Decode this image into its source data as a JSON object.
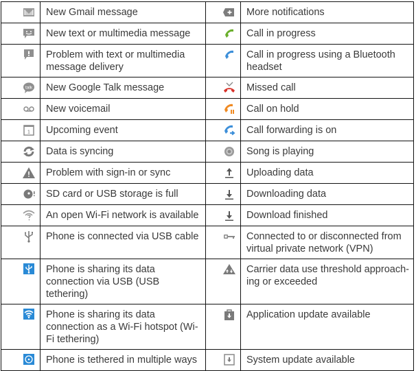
{
  "colors": {
    "gray_icon": "#8a8a8a",
    "call_green": "#6aaf2c",
    "call_blue": "#3d8fd9",
    "missed_red": "#d8332b",
    "hold_orange": "#f08a22",
    "tether_blue": "#2a8ad6"
  },
  "rows": [
    {
      "left": {
        "icon": "gmail-icon",
        "text": "New Gmail message"
      },
      "right": {
        "icon": "more-notifications-icon",
        "text": "More notifications"
      }
    },
    {
      "left": {
        "icon": "text-message-icon",
        "text": "New text or multimedia message"
      },
      "right": {
        "icon": "call-in-progress-icon",
        "text": "Call in progress"
      }
    },
    {
      "left": {
        "icon": "message-error-icon",
        "text": "Problem with text or multimedia message delivery"
      },
      "right": {
        "icon": "bluetooth-call-icon",
        "text": "Call in progress using a Bluetooth headset"
      }
    },
    {
      "left": {
        "icon": "google-talk-icon",
        "text": "New Google Talk message"
      },
      "right": {
        "icon": "missed-call-icon",
        "text": "Missed call"
      }
    },
    {
      "left": {
        "icon": "voicemail-icon",
        "text": "New voicemail"
      },
      "right": {
        "icon": "call-on-hold-icon",
        "text": "Call on hold"
      }
    },
    {
      "left": {
        "icon": "calendar-icon",
        "text": "Upcoming event"
      },
      "right": {
        "icon": "call-forwarding-icon",
        "text": "Call forwarding is on"
      }
    },
    {
      "left": {
        "icon": "sync-icon",
        "text": "Data is syncing"
      },
      "right": {
        "icon": "song-playing-icon",
        "text": "Song is playing"
      }
    },
    {
      "left": {
        "icon": "warning-icon",
        "text": "Problem with sign-in or sync"
      },
      "right": {
        "icon": "upload-icon",
        "text": "Uploading data"
      }
    },
    {
      "left": {
        "icon": "storage-full-icon",
        "text": "SD card or USB storage is full"
      },
      "right": {
        "icon": "download-icon",
        "text": "Downloading data"
      }
    },
    {
      "left": {
        "icon": "open-wifi-icon",
        "text": "An open Wi-Fi network is available"
      },
      "right": {
        "icon": "download-finished-icon",
        "text": "Download finished"
      }
    },
    {
      "left": {
        "icon": "usb-icon",
        "text": "Phone is connected via USB cable"
      },
      "right": {
        "icon": "vpn-key-icon",
        "text": "Connected to or disconnected from virtual private network (VPN)"
      }
    },
    {
      "left": {
        "icon": "usb-tethering-icon",
        "text": "Phone is sharing its data connection via USB (USB tethering)"
      },
      "right": {
        "icon": "data-threshold-icon",
        "text": "Carrier data use threshold approach-ing or exceeded"
      }
    },
    {
      "left": {
        "icon": "wifi-hotspot-icon",
        "text": "Phone is sharing its data connection as a Wi-Fi hotspot (Wi-Fi tethering)"
      },
      "right": {
        "icon": "app-update-icon",
        "text": "Application update available"
      }
    },
    {
      "left": {
        "icon": "multiple-tethering-icon",
        "text": "Phone is tethered in multiple ways"
      },
      "right": {
        "icon": "system-update-icon",
        "text": "System update available"
      }
    }
  ]
}
